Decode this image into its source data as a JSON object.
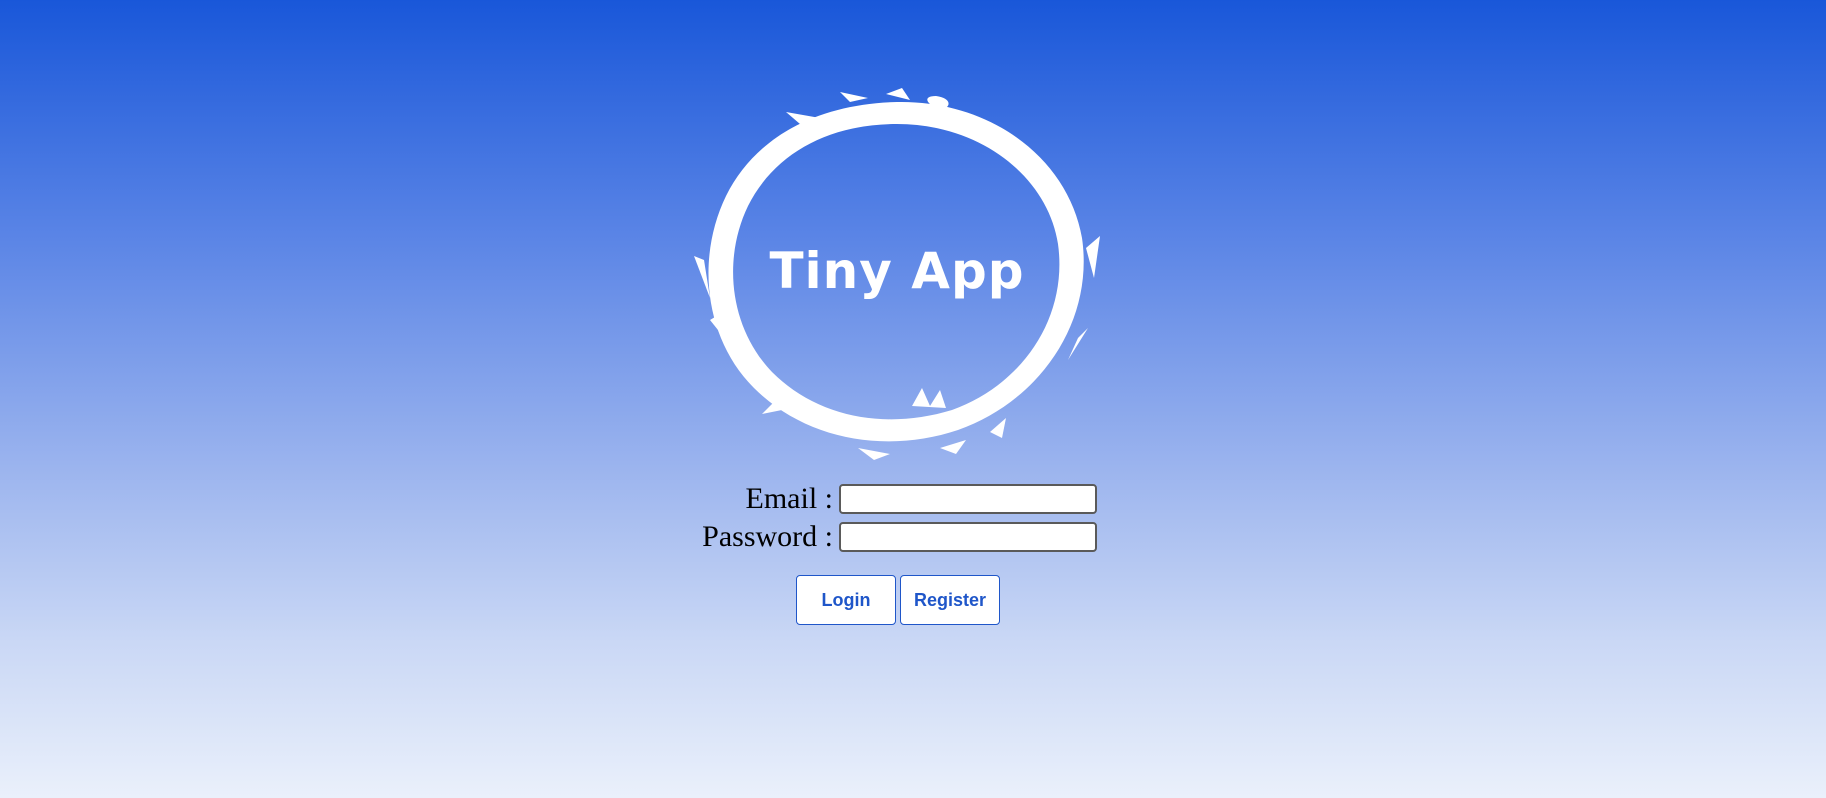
{
  "logo": {
    "text": "Tiny App",
    "icon": "brush-circle-icon"
  },
  "form": {
    "email_label": "Email :",
    "email_value": "",
    "password_label": "Password :",
    "password_value": ""
  },
  "buttons": {
    "login_label": "Login",
    "register_label": "Register"
  },
  "colors": {
    "background_top": "#1957d9",
    "background_bottom": "#eaf0fb",
    "button_accent": "#1f56c9",
    "logo": "#ffffff"
  }
}
